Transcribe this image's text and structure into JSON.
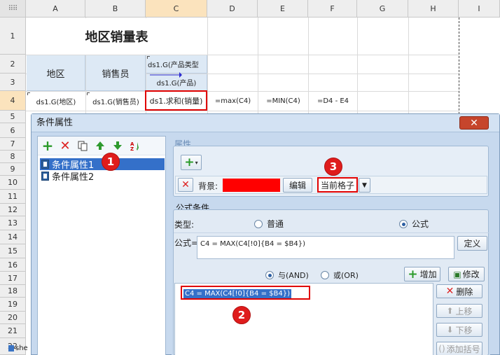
{
  "sheet": {
    "columns": [
      "A",
      "B",
      "C",
      "D",
      "E",
      "F",
      "G",
      "H",
      "I"
    ],
    "rows": [
      "1",
      "2",
      "3",
      "4",
      "5",
      "6",
      "7",
      "8",
      "9",
      "10",
      "11",
      "12",
      "13",
      "14",
      "15",
      "16",
      "17",
      "18",
      "19",
      "20",
      "21",
      "22"
    ],
    "title": "地区销量表",
    "header_region": "地区",
    "header_salesperson": "销售员",
    "header_product_type": "ds1.G(产品类型",
    "header_product": "ds1.G(产品)",
    "cell_a4": "ds1.G(地区)",
    "cell_b4": "ds1.G(销售员)",
    "cell_c4": "ds1.求和(销量)",
    "cell_d4": "=max(C4)",
    "cell_e4": "=MIN(C4)",
    "cell_f4": "=D4 - E4",
    "sheet_tab": "she"
  },
  "dialog": {
    "title": "条件属性",
    "close_glyph": "✕",
    "conditions": [
      "条件属性1",
      "条件属性2"
    ],
    "properties_label": "属性",
    "background_label": "背景:",
    "background_color": "#ff0000",
    "edit_button": "编辑",
    "scope_value": "当前格子",
    "formula_group_label": "公式条件",
    "type_label": "类型:",
    "type_normal": "普通",
    "type_formula": "公式",
    "formula_label": "公式=",
    "formula_value": "C4 = MAX(C4[!0]{B4 = $B4})",
    "define_button": "定义",
    "and_label": "与(AND)",
    "or_label": "或(OR)",
    "add_button": "增加",
    "modify_button": "修改",
    "delete_button": "删除",
    "up_button": "上移",
    "down_button": "下移",
    "add_bracket_button": "添加括号",
    "condition_entry": "C4 = MAX(C4[!0]{B4 = $B4})"
  },
  "badges": [
    "1",
    "2",
    "3"
  ],
  "colors": {
    "selection_blue": "#3470c9",
    "highlight_red": "#e00000"
  }
}
